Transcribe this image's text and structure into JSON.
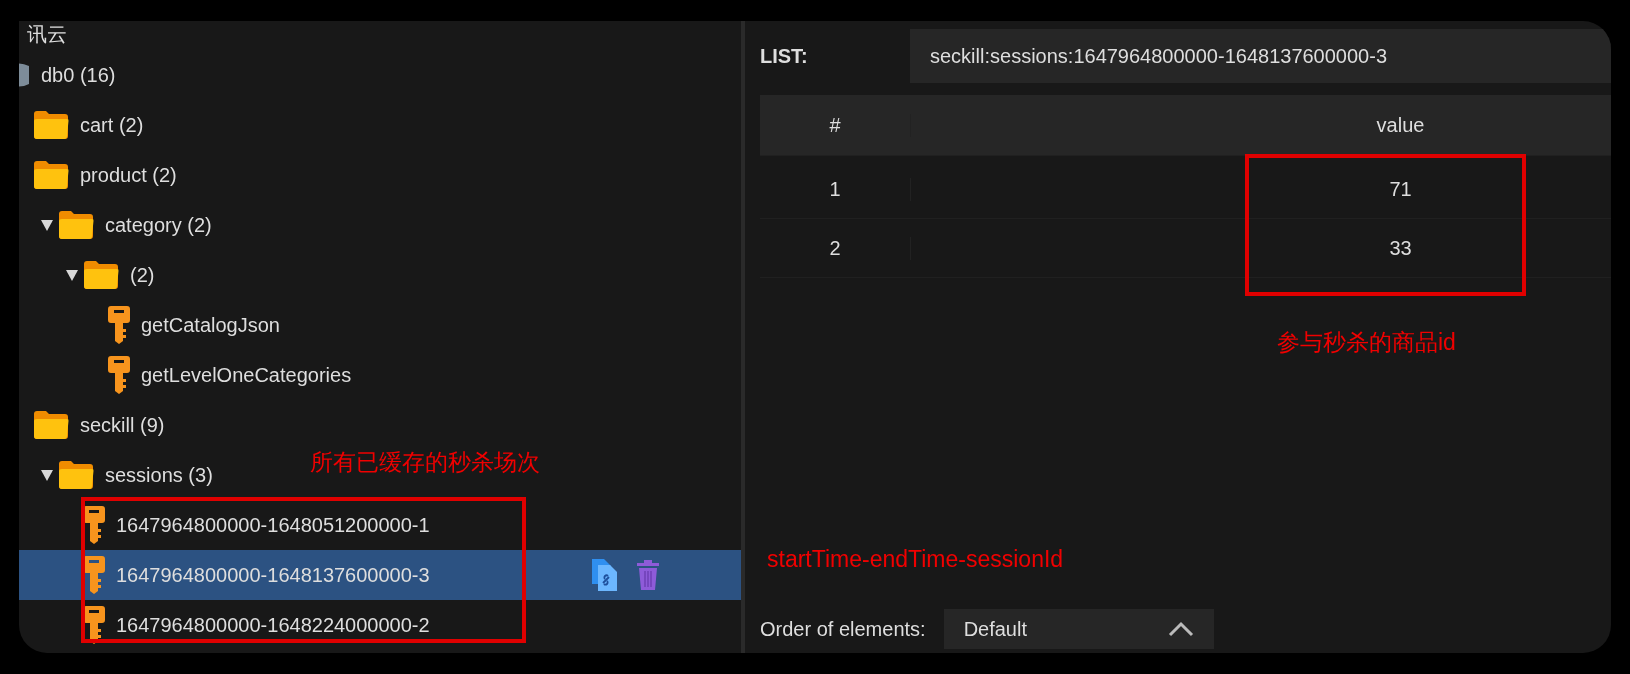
{
  "window": {
    "title": "讯云"
  },
  "tree": [
    {
      "kind": "database",
      "label": "db0  (16)",
      "children": [
        {
          "kind": "folder",
          "label": "cart (2)"
        },
        {
          "kind": "folder",
          "label": "product (2)",
          "children": [
            {
              "kind": "folder",
              "label": "category (2)",
              "expanded": true,
              "children": [
                {
                  "kind": "folder",
                  "label": "(2)",
                  "expanded": true,
                  "children": [
                    {
                      "kind": "key",
                      "label": "getCatalogJson",
                      "selected": false
                    },
                    {
                      "kind": "key",
                      "label": "getLevelOneCategories",
                      "selected": false
                    }
                  ]
                }
              ]
            }
          ]
        },
        {
          "kind": "folder",
          "label": "seckill (9)",
          "children": [
            {
              "kind": "folder",
              "label": "sessions (3)",
              "expanded": true,
              "children": [
                {
                  "kind": "key",
                  "label": "1647964800000-1648051200000-1",
                  "selected": false
                },
                {
                  "kind": "key",
                  "label": "1647964800000-1648137600000-3",
                  "selected": true
                },
                {
                  "kind": "key",
                  "label": "1647964800000-1648224000000-2",
                  "selected": false
                }
              ]
            }
          ]
        }
      ]
    }
  ],
  "detail": {
    "type_label": "LIST:",
    "key_name": "seckill:sessions:1647964800000-1648137600000-3",
    "columns": [
      "#",
      "value"
    ],
    "rows": [
      {
        "index": "1",
        "value": "71"
      },
      {
        "index": "2",
        "value": "33"
      }
    ],
    "order": {
      "label": "Order of elements:",
      "value": "Default"
    }
  },
  "annotations": {
    "sessions_note": "所有已缓存的秒杀场次",
    "products_note": "参与秒杀的商品id",
    "format_note": "startTime-endTime-sessionId"
  }
}
